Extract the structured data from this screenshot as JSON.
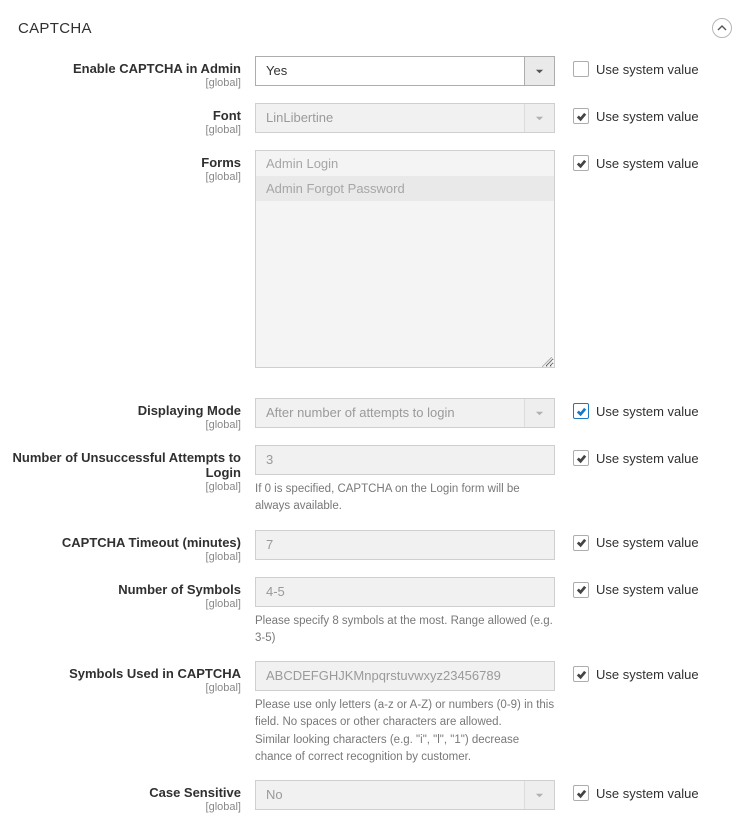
{
  "section": {
    "title": "CAPTCHA"
  },
  "scope_label": "[global]",
  "use_system_label": "Use system value",
  "fields": {
    "enable": {
      "label": "Enable CAPTCHA in Admin",
      "value": "Yes",
      "use_system": false
    },
    "font": {
      "label": "Font",
      "value": "LinLibertine",
      "use_system": true
    },
    "forms": {
      "label": "Forms",
      "options": [
        "Admin Login",
        "Admin Forgot Password"
      ],
      "use_system": true
    },
    "mode": {
      "label": "Displaying Mode",
      "value": "After number of attempts to login",
      "use_system": true,
      "highlight": true
    },
    "attempts": {
      "label": "Number of Unsuccessful Attempts to Login",
      "value": "3",
      "help": "If 0 is specified, CAPTCHA on the Login form will be always available.",
      "use_system": true
    },
    "timeout": {
      "label": "CAPTCHA Timeout (minutes)",
      "value": "7",
      "use_system": true
    },
    "symbols": {
      "label": "Number of Symbols",
      "value": "4-5",
      "help": "Please specify 8 symbols at the most. Range allowed (e.g. 3-5)",
      "use_system": true
    },
    "symbols_used": {
      "label": "Symbols Used in CAPTCHA",
      "value": "ABCDEFGHJKMnpqrstuvwxyz23456789",
      "help": "Please use only letters (a-z or A-Z) or numbers (0-9) in this field. No spaces or other characters are allowed.\nSimilar looking characters (e.g. \"i\", \"l\", \"1\") decrease chance of correct recognition by customer.",
      "use_system": true
    },
    "case": {
      "label": "Case Sensitive",
      "value": "No",
      "use_system": true
    }
  }
}
